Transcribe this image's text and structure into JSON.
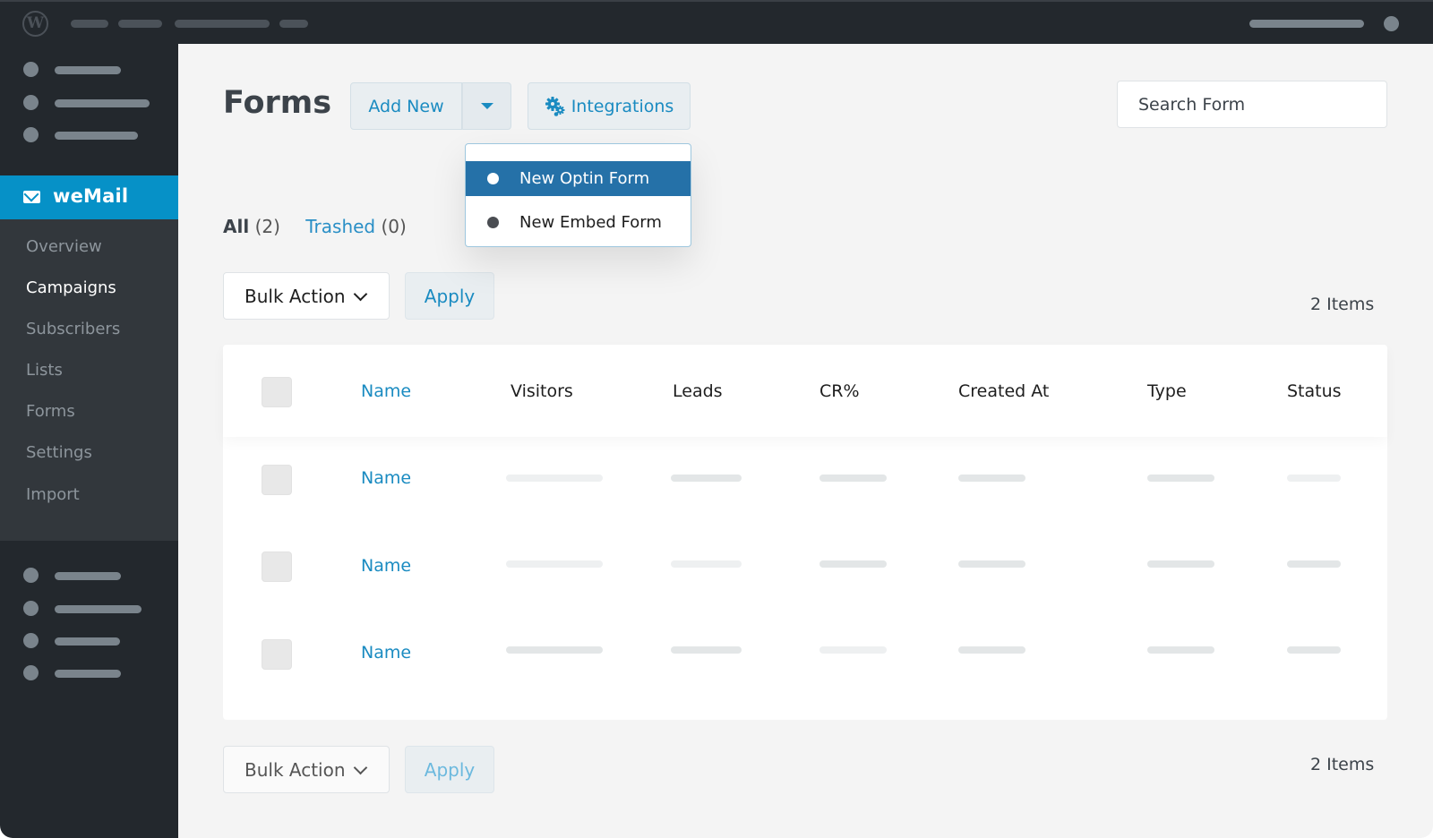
{
  "topbar": {
    "logo_icon": "wordpress-logo-icon",
    "logo_glyph": "W"
  },
  "sidebar": {
    "brand": {
      "label": "weMail",
      "icon": "mail-icon"
    },
    "items": [
      {
        "label": "Overview",
        "active": false
      },
      {
        "label": "Campaigns",
        "active": true
      },
      {
        "label": "Subscribers",
        "active": false
      },
      {
        "label": "Lists",
        "active": false
      },
      {
        "label": "Forms",
        "active": false
      },
      {
        "label": "Settings",
        "active": false
      },
      {
        "label": "Import",
        "active": false
      }
    ]
  },
  "header": {
    "title": "Forms",
    "add_new_label": "Add New",
    "integrations_label": "Integrations",
    "search_placeholder": "Search Form"
  },
  "add_new_menu": {
    "options": [
      {
        "label": "New Optin Form",
        "selected": true
      },
      {
        "label": "New Embed Form",
        "selected": false
      }
    ]
  },
  "filters": {
    "all_label": "All",
    "all_count": "(2)",
    "trashed_label": "Trashed",
    "trashed_count": "(0)"
  },
  "toolbar_top": {
    "bulk_action_label": "Bulk Action",
    "apply_label": "Apply",
    "items_count": "2 Items"
  },
  "table": {
    "columns": [
      "Name",
      "Visitors",
      "Leads",
      "CR%",
      "Created At",
      "Type",
      "Status"
    ],
    "rows": [
      {
        "name": "Name"
      },
      {
        "name": "Name"
      },
      {
        "name": "Name"
      }
    ]
  },
  "toolbar_bottom": {
    "bulk_action_label": "Bulk Action",
    "apply_label": "Apply",
    "items_count": "2 Items"
  },
  "colors": {
    "brand": "#0691c7",
    "link": "#1a8bc1",
    "menu_selected": "#2571a8",
    "admin_bar": "#23282d",
    "submenu": "#32373c"
  }
}
